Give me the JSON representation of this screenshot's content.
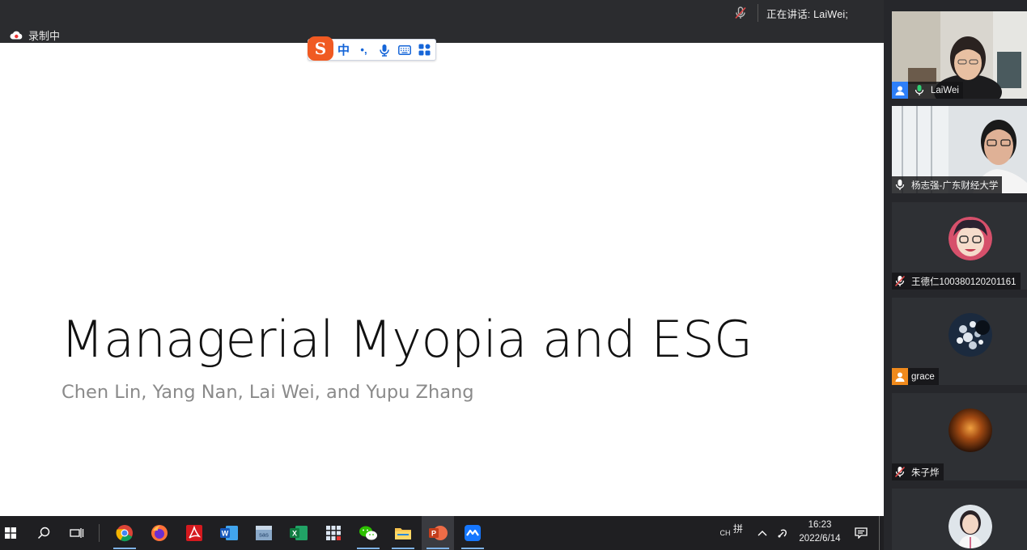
{
  "meeting": {
    "recording_label": "录制中",
    "speaking_label": "正在讲话: LaiWei;"
  },
  "ime_toolbar": {
    "logo": "S",
    "mode": "中",
    "punct": "•,",
    "items": [
      "voice",
      "keyboard",
      "toolbox"
    ]
  },
  "slide": {
    "title": "Managerial Myopia and ESG",
    "authors": "Chen Lin, Yang Nan, Lai Wei, and Yupu Zhang"
  },
  "participants": [
    {
      "name": "LaiWei",
      "mic": "on",
      "host": true,
      "video": true
    },
    {
      "name": "杨志强-广东财经大学",
      "mic": "on",
      "video": true
    },
    {
      "name": "王德仁100380120201161",
      "mic": "muted",
      "video": false
    },
    {
      "name": "grace",
      "mic": "none",
      "video": false
    },
    {
      "name": "朱子烨",
      "mic": "muted",
      "video": false
    },
    {
      "name": "",
      "mic": "none",
      "video": false
    }
  ],
  "taskbar": {
    "apps": [
      "Chrome",
      "Firefox",
      "Acrobat",
      "Word",
      "SAS",
      "Excel",
      "Apps",
      "WeChat",
      "File Explorer",
      "PowerPoint",
      "Tencent Meeting"
    ],
    "lang": "CH",
    "ime_icon": "拼",
    "time": "16:23",
    "date": "2022/6/14"
  },
  "colors": {
    "active_speaker": "#27c26b",
    "ime_blue": "#1565d8",
    "sogou_orange": "#f05a22",
    "taskbar": "#1f1f22"
  }
}
